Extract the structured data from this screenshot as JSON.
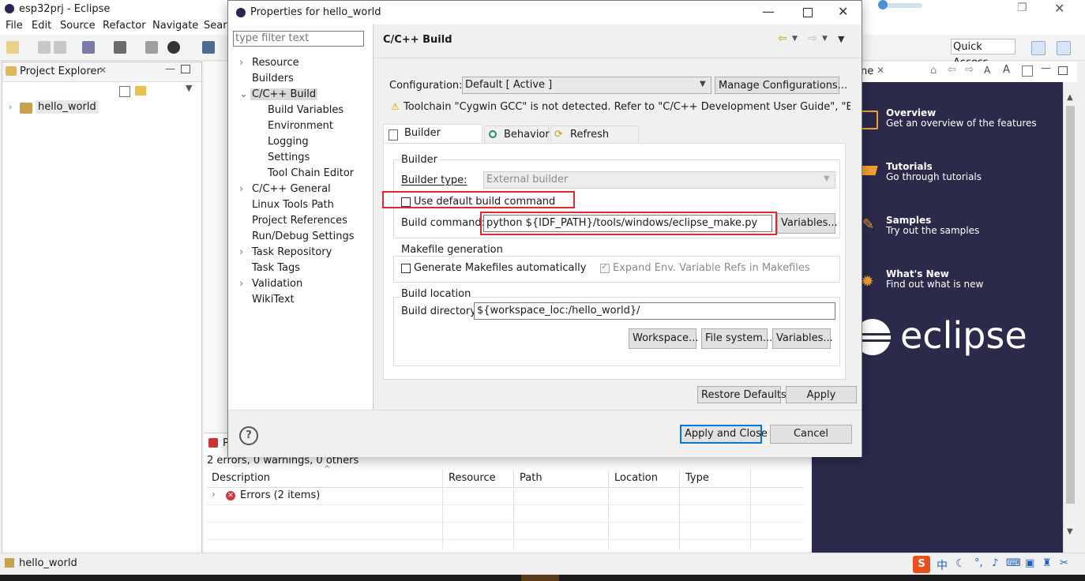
{
  "eclipse": {
    "title": "esp32prj - Eclipse",
    "menu": [
      "File",
      "Edit",
      "Source",
      "Refactor",
      "Navigate",
      "Sear"
    ],
    "quick_access": "Quick Access"
  },
  "project_explorer": {
    "title": "Project Explorer",
    "project": "hello_world"
  },
  "problems": {
    "tab_label": "P",
    "summary": "2 errors, 0 warnings, 0 others",
    "columns": [
      "Description",
      "Resource",
      "Path",
      "Location",
      "Type"
    ],
    "rows": [
      {
        "description": "Errors (2 items)"
      }
    ]
  },
  "welcome": {
    "tab_suffix": "ne",
    "items": [
      {
        "title": "Overview",
        "desc": "Get an overview of the features"
      },
      {
        "title": "Tutorials",
        "desc": "Go through tutorials"
      },
      {
        "title": "Samples",
        "desc": "Try out the samples"
      },
      {
        "title": "What's New",
        "desc": "Find out what is new"
      }
    ],
    "logo_text": "eclipse"
  },
  "statusbar": {
    "project": "hello_world"
  },
  "dialog": {
    "title": "Properties for hello_world",
    "filter_placeholder": "type filter text",
    "tree": [
      {
        "label": "Resource",
        "level": 0,
        "expander": ">"
      },
      {
        "label": "Builders",
        "level": 0,
        "expander": ""
      },
      {
        "label": "C/C++ Build",
        "level": 0,
        "expander": "v",
        "selected": true
      },
      {
        "label": "Build Variables",
        "level": 1,
        "expander": ""
      },
      {
        "label": "Environment",
        "level": 1,
        "expander": ""
      },
      {
        "label": "Logging",
        "level": 1,
        "expander": ""
      },
      {
        "label": "Settings",
        "level": 1,
        "expander": ""
      },
      {
        "label": "Tool Chain Editor",
        "level": 1,
        "expander": ""
      },
      {
        "label": "C/C++ General",
        "level": 0,
        "expander": ">"
      },
      {
        "label": "Linux Tools Path",
        "level": 0,
        "expander": ""
      },
      {
        "label": "Project References",
        "level": 0,
        "expander": ""
      },
      {
        "label": "Run/Debug Settings",
        "level": 0,
        "expander": ""
      },
      {
        "label": "Task Repository",
        "level": 0,
        "expander": ">"
      },
      {
        "label": "Task Tags",
        "level": 0,
        "expander": ""
      },
      {
        "label": "Validation",
        "level": 0,
        "expander": ">"
      },
      {
        "label": "WikiText",
        "level": 0,
        "expander": ""
      }
    ],
    "page_title": "C/C++ Build",
    "configuration_label": "Configuration:",
    "configuration_value": "Default  [ Active ]",
    "manage_configurations": "Manage Configurations...",
    "warning": "Toolchain \"Cygwin GCC\" is not detected. Refer to \"C/C++ Development User Guide\", \"Before you",
    "tabs": [
      "Builder Settings",
      "Behavior",
      "Refresh Policy"
    ],
    "builder_group": "Builder",
    "builder_type_label": "Builder type:",
    "builder_type_value": "External builder",
    "use_default_build_command": "Use default build command",
    "build_command_label": "Build command:",
    "build_command_value": "python ${IDF_PATH}/tools/windows/eclipse_make.py",
    "variables_button": "Variables...",
    "makefile_group": "Makefile generation",
    "generate_makefiles": "Generate Makefiles automatically",
    "expand_env_refs": "Expand Env. Variable Refs in Makefiles",
    "build_location_group": "Build location",
    "build_directory_label": "Build directory:",
    "build_directory_value": "${workspace_loc:/hello_world}/",
    "workspace_button": "Workspace...",
    "filesystem_button": "File system...",
    "variables2_button": "Variables...",
    "restore_defaults": "Restore Defaults",
    "apply": "Apply",
    "apply_and_close": "Apply and Close",
    "cancel": "Cancel",
    "help": "?"
  }
}
